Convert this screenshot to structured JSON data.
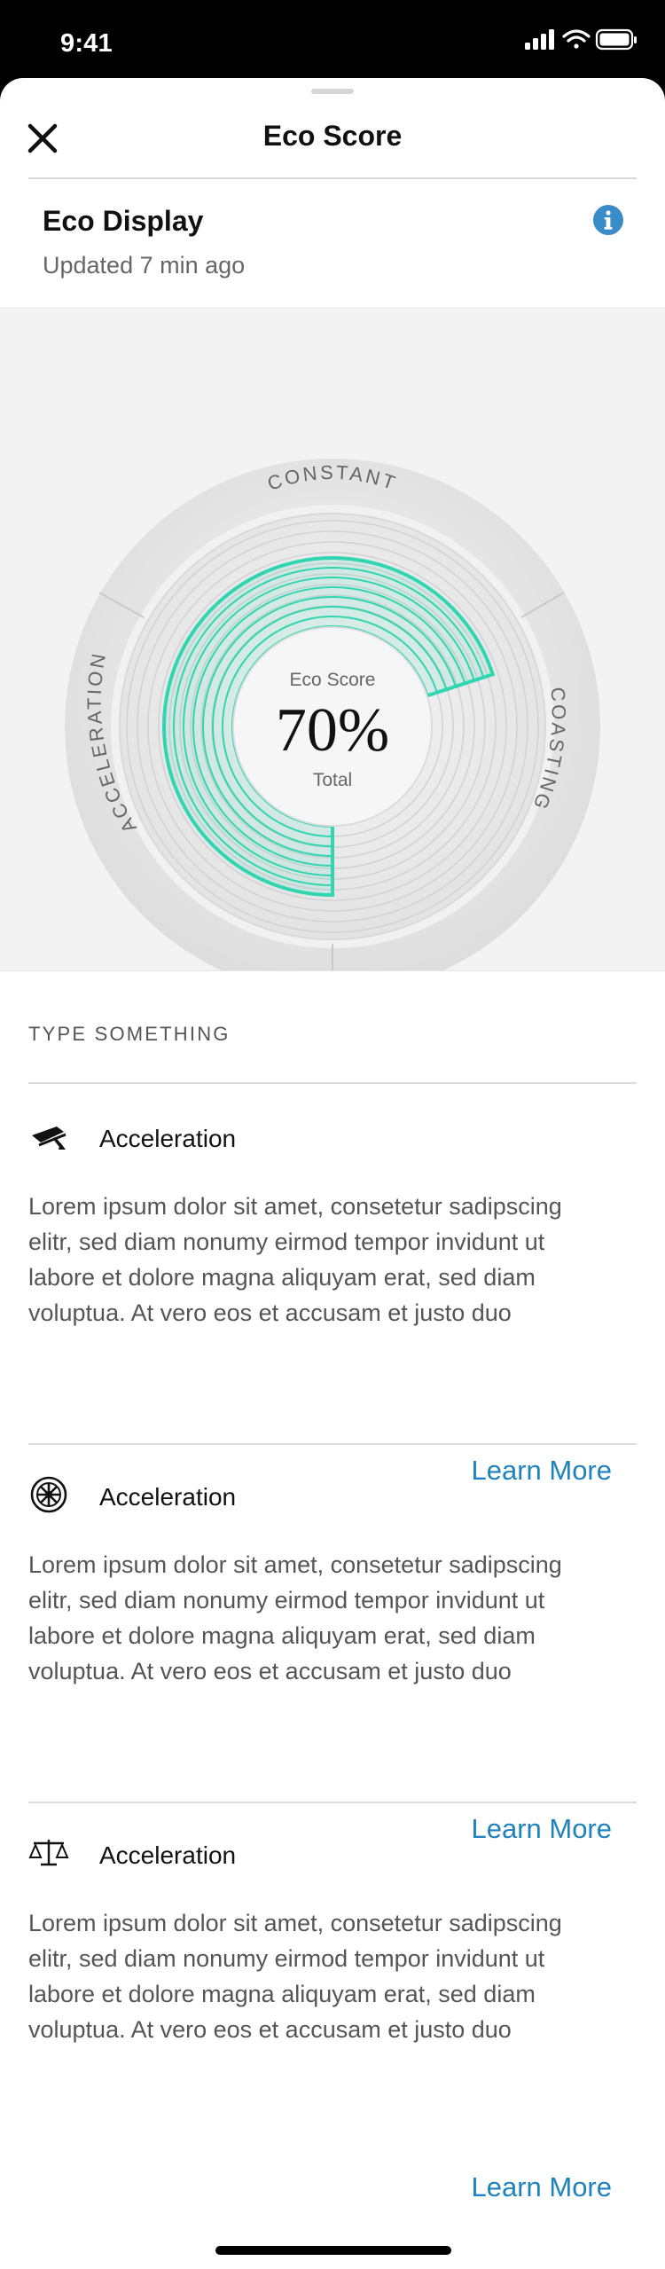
{
  "status_bar": {
    "time": "9:41"
  },
  "header": {
    "title": "Eco Score",
    "close_icon": "close-icon"
  },
  "eco_display": {
    "title": "Eco Display",
    "updated": "Updated 7 min ago",
    "info_icon": "info-icon"
  },
  "gauge": {
    "center_label": "Eco Score",
    "center_value": "70%",
    "center_sub": "Total",
    "segments": [
      {
        "label": "CONSTANT"
      },
      {
        "label": "COASTING"
      },
      {
        "label": "ACCELERATION"
      }
    ],
    "accent_color": "#2fd6b0",
    "score_fraction": 0.7
  },
  "section": {
    "label": "TYPE SOMETHING"
  },
  "items": [
    {
      "icon": "acceleration-pedal-icon",
      "title": "Acceleration",
      "text": [
        "Lorem ipsum dolor sit amet, consetetur sadipscing",
        "elitr, sed diam nonumy eirmod tempor invidunt ut",
        "labore et dolore magna aliquyam erat, sed diam",
        "voluptua. At vero eos et accusam et justo duo"
      ],
      "link": "Learn More"
    },
    {
      "icon": "turbine-wheel-icon",
      "title": "Acceleration",
      "text": [
        "Lorem ipsum dolor sit amet, consetetur sadipscing",
        "elitr, sed diam nonumy eirmod tempor invidunt ut",
        "labore et dolore magna aliquyam erat, sed diam",
        "voluptua. At vero eos et accusam et justo duo"
      ],
      "link": "Learn More"
    },
    {
      "icon": "balance-scale-icon",
      "title": "Acceleration",
      "text": [
        "Lorem ipsum dolor sit amet, consetetur sadipscing",
        "elitr, sed diam nonumy eirmod tempor invidunt ut",
        "labore et dolore magna aliquyam erat, sed diam",
        "voluptua. At vero eos et accusam et justo duo"
      ],
      "link": "Learn More"
    }
  ],
  "colors": {
    "accent": "#2fd6b0",
    "link": "#1f82bf",
    "info": "#3a8cc9"
  }
}
